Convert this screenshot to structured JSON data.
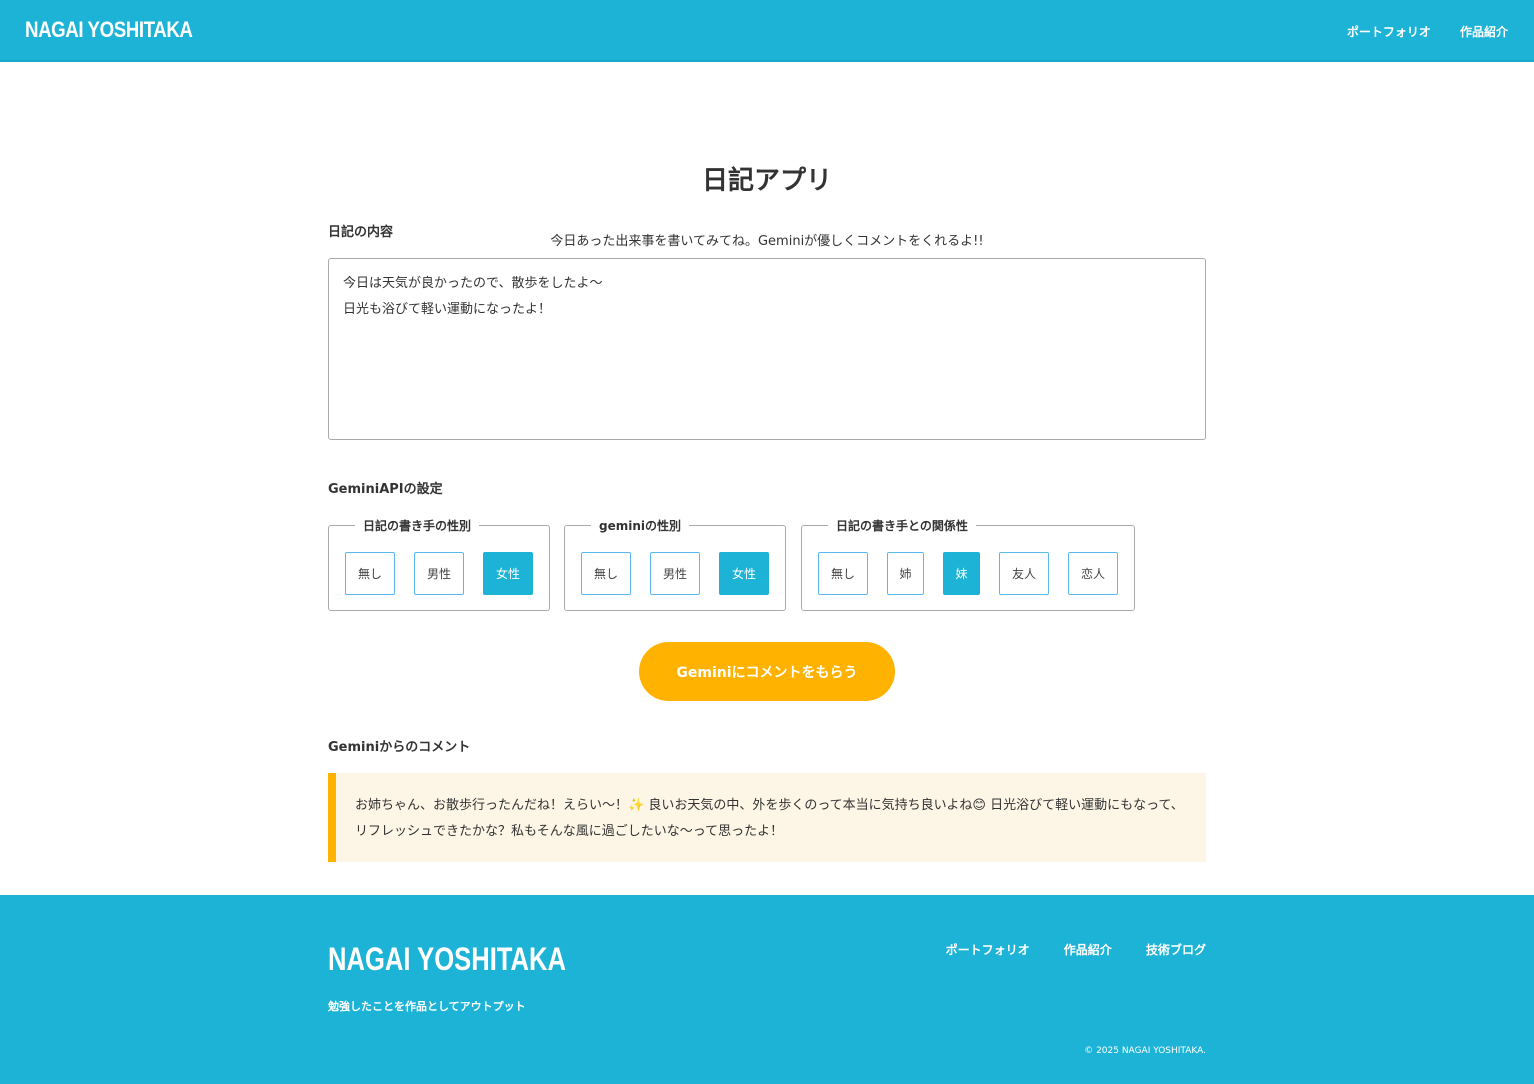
{
  "header": {
    "logo": "NAGAI YOSHITAKA",
    "nav": [
      "ポートフォリオ",
      "作品紹介"
    ]
  },
  "page": {
    "title": "日記アプリ",
    "lead": "今日あった出来事を書いてみてね。Geminiが優しくコメントをくれるよ!!"
  },
  "diary": {
    "label": "日記の内容",
    "value": "今日は天気が良かったので、散歩をしたよ〜\n日光も浴びて軽い運動になったよ！"
  },
  "settings": {
    "label": "GeminiAPIの設定",
    "groups": [
      {
        "legend": "日記の書き手の性別",
        "options": [
          "無し",
          "男性",
          "女性"
        ],
        "selected": "女性"
      },
      {
        "legend": "geminiの性別",
        "options": [
          "無し",
          "男性",
          "女性"
        ],
        "selected": "女性"
      },
      {
        "legend": "日記の書き手との関係性",
        "options": [
          "無し",
          "姉",
          "妹",
          "友人",
          "恋人"
        ],
        "selected": "妹"
      }
    ]
  },
  "cta": "Geminiにコメントをもらう",
  "comment": {
    "label": "Geminiからのコメント",
    "text": "お姉ちゃん、お散歩行ったんだね！えらい〜！✨ 良いお天気の中、外を歩くのって本当に気持ち良いよね😊 日光浴びて軽い運動にもなって、リフレッシュできたかな？私もそんな風に過ごしたいな〜って思ったよ！"
  },
  "footer": {
    "logo": "NAGAI YOSHITAKA",
    "tagline": "勉強したことを作品としてアウトプット",
    "nav": [
      "ポートフォリオ",
      "作品紹介",
      "技術ブログ"
    ],
    "copyright": "© 2025 NAGAI YOSHITAKA."
  },
  "colors": {
    "primary": "#1db3d6",
    "accent": "#ffb300"
  }
}
